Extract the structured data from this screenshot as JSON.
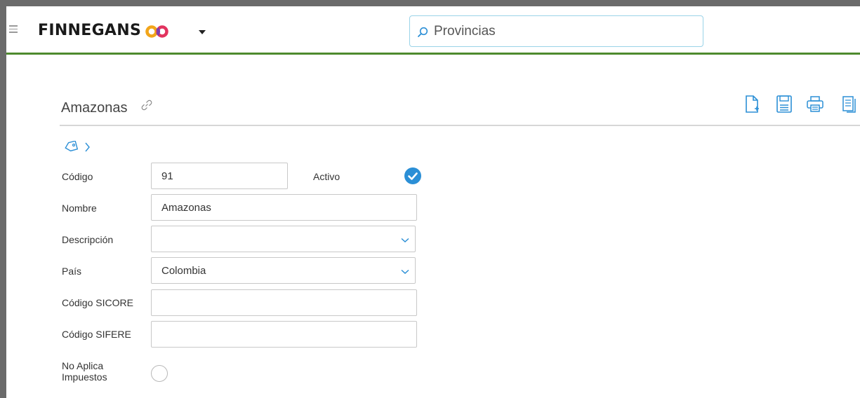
{
  "header": {
    "brand": "FINNEGANS",
    "search_value": "Provincias",
    "accent_color": "#4e8a2e"
  },
  "record": {
    "title": "Amazonas"
  },
  "toolbar": {
    "icons": [
      "new-document-icon",
      "save-icon",
      "print-icon",
      "copy-icon"
    ]
  },
  "form": {
    "codigo_label": "Código",
    "codigo_value": "91",
    "activo_label": "Activo",
    "nombre_label": "Nombre",
    "nombre_value": "Amazonas",
    "descripcion_label": "Descripción",
    "descripcion_value": "",
    "pais_label": "País",
    "pais_value": "Colombia",
    "sicore_label": "Código SICORE",
    "sicore_value": "",
    "sifere_label": "Código SIFERE",
    "sifere_value": "",
    "no_aplica_label_1": "No Aplica",
    "no_aplica_label_2": "Impuestos"
  }
}
